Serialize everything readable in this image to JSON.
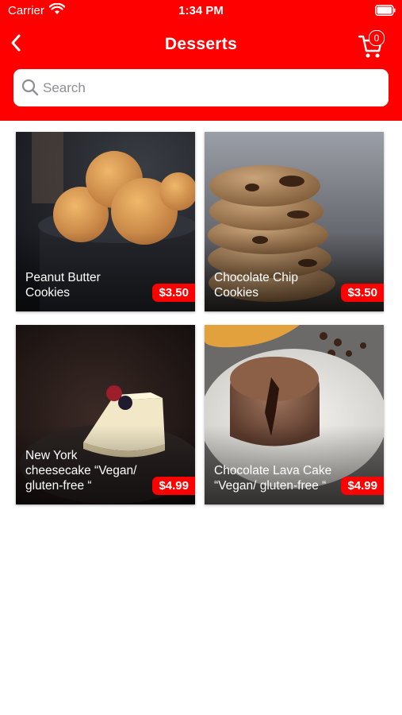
{
  "status_bar": {
    "carrier": "Carrier",
    "time": "1:34 PM"
  },
  "nav": {
    "title": "Desserts",
    "cart_count": "0"
  },
  "search": {
    "placeholder": "Search"
  },
  "colors": {
    "brand": "#fe0000",
    "text_on_brand": "#ffffff"
  },
  "products": [
    {
      "name": "Peanut Butter Cookies",
      "price": "$3.50",
      "icon": "peanut-butter-cookies-photo"
    },
    {
      "name": "Chocolate Chip Cookies",
      "price": "$3.50",
      "icon": "chocolate-chip-cookies-photo"
    },
    {
      "name": "New York cheesecake “Vegan/ gluten-free “",
      "price": "$4.99",
      "icon": "cheesecake-photo"
    },
    {
      "name": "Chocolate Lava Cake “Vegan/ gluten-free “",
      "price": "$4.99",
      "icon": "lava-cake-photo"
    }
  ]
}
